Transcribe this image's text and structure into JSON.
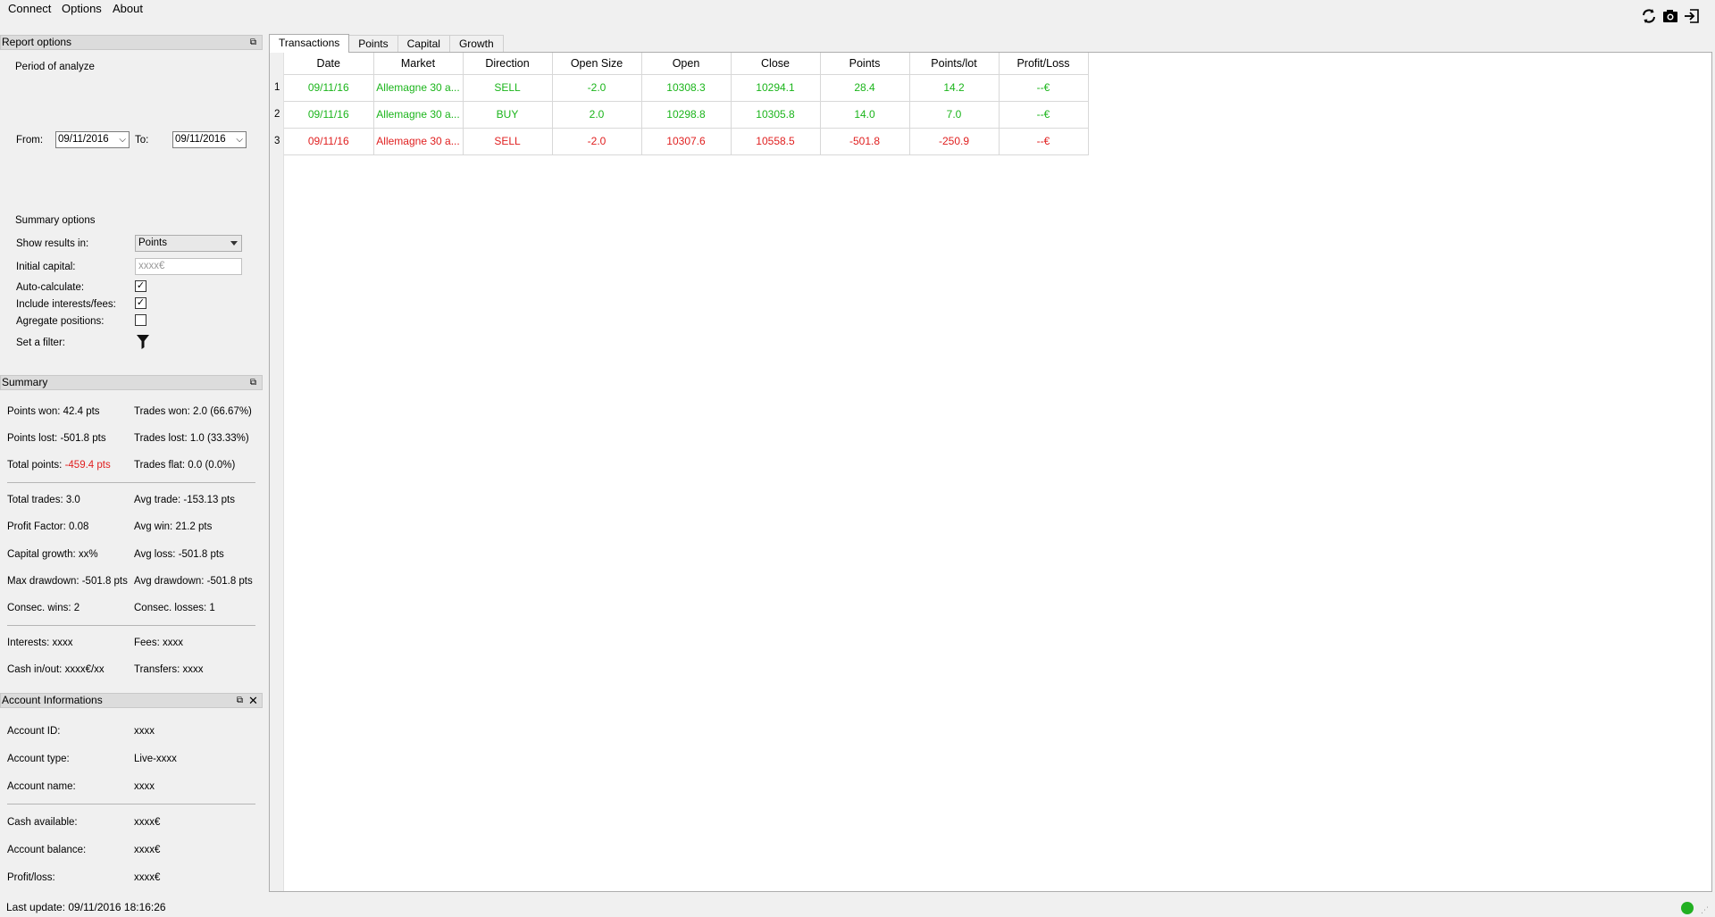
{
  "menu": {
    "connect": "Connect",
    "options": "Options",
    "about": "About"
  },
  "toolbar": {
    "icons": [
      "refresh-icon",
      "camera-icon",
      "logout-icon"
    ]
  },
  "report_options": {
    "title": "Report options",
    "period_label": "Period of analyze",
    "from_label": "From:",
    "from_value": "09/11/2016",
    "to_label": "To:",
    "to_value": "09/11/2016",
    "summary_options_label": "Summary options",
    "show_results_label": "Show results in:",
    "show_results_value": "Points",
    "initial_capital_label": "Initial capital:",
    "initial_capital_placeholder": "xxxx€",
    "auto_calculate_label": "Auto-calculate:",
    "auto_calculate_checked": true,
    "include_interests_label": "Include interests/fees:",
    "include_interests_checked": true,
    "aggregate_label": "Agregate positions:",
    "aggregate_checked": false,
    "filter_label": "Set a filter:"
  },
  "summary": {
    "title": "Summary",
    "points_won": "Points won: 42.4 pts",
    "trades_won": "Trades won: 2.0 (66.67%)",
    "points_lost": "Points lost: -501.8 pts",
    "trades_lost": "Trades lost: 1.0 (33.33%)",
    "total_points_label": "Total points: ",
    "total_points_value": "-459.4 pts",
    "trades_flat": "Trades flat: 0.0 (0.0%)",
    "total_trades": "Total trades: 3.0",
    "avg_trade": "Avg trade: -153.13 pts",
    "profit_factor": "Profit Factor: 0.08",
    "avg_win": "Avg win: 21.2 pts",
    "capital_growth": "Capital growth: xx%",
    "avg_loss": "Avg loss: -501.8 pts",
    "max_drawdown": "Max drawdown: -501.8 pts",
    "avg_drawdown": "Avg drawdown: -501.8 pts",
    "consec_wins": "Consec. wins: 2",
    "consec_losses": "Consec. losses: 1",
    "interests": "Interests: xxxx",
    "fees": "Fees: xxxx",
    "cash_inout": "Cash in/out: xxxx€/xx",
    "transfers": "Transfers: xxxx"
  },
  "account": {
    "title": "Account Informations",
    "id_label": "Account ID:",
    "id_value": "xxxx",
    "type_label": "Account type:",
    "type_value": "Live-xxxx",
    "name_label": "Account name:",
    "name_value": "xxxx",
    "cash_label": "Cash available:",
    "cash_value": "xxxx€",
    "balance_label": "Account balance:",
    "balance_value": "xxxx€",
    "pl_label": "Profit/loss:",
    "pl_value": "xxxx€"
  },
  "tabs": [
    "Transactions",
    "Points",
    "Capital",
    "Growth"
  ],
  "table": {
    "columns": [
      "Date",
      "Market",
      "Direction",
      "Open Size",
      "Open",
      "Close",
      "Points",
      "Points/lot",
      "Profit/Loss"
    ],
    "rows": [
      {
        "num": "1",
        "color": "#1bb51b",
        "cells": [
          "09/11/16",
          "Allemagne 30 a...",
          "SELL",
          "-2.0",
          "10308.3",
          "10294.1",
          "28.4",
          "14.2",
          "--€"
        ]
      },
      {
        "num": "2",
        "color": "#1bb51b",
        "cells": [
          "09/11/16",
          "Allemagne 30 a...",
          "BUY",
          "2.0",
          "10298.8",
          "10305.8",
          "14.0",
          "7.0",
          "--€"
        ]
      },
      {
        "num": "3",
        "color": "#e02020",
        "cells": [
          "09/11/16",
          "Allemagne 30 a...",
          "SELL",
          "-2.0",
          "10307.6",
          "10558.5",
          "-501.8",
          "-250.9",
          "--€"
        ]
      }
    ]
  },
  "status": {
    "last_update": "Last update: 09/11/2016 18:16:26",
    "connection_color": "#22b022"
  }
}
